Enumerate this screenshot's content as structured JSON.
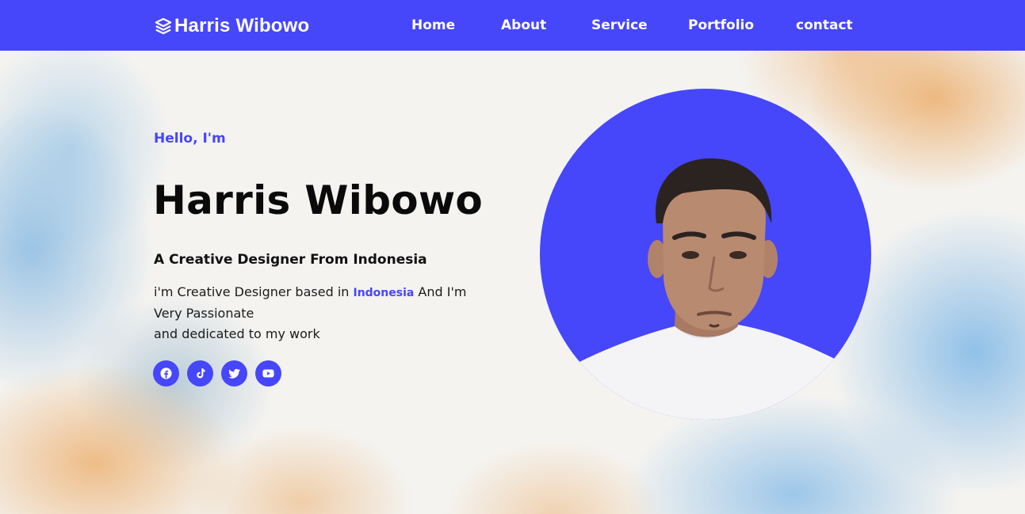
{
  "nav": {
    "brand": "Harris Wibowo",
    "brand_icon": "layers-icon",
    "links": [
      "Home",
      "About",
      "Service",
      "Portfolio",
      "contact"
    ],
    "background": "#4646fa"
  },
  "hero": {
    "greeting": "Hello, I'm",
    "name": "Harris Wibowo",
    "tagline": "A Creative Designer From Indonesia",
    "desc_before": "i'm Creative Designer based in ",
    "desc_highlight": "Indonesia",
    "desc_after": " And I'm Very Passionate",
    "desc_line2": "and dedicated to my work",
    "socials": [
      "facebook-icon",
      "tiktok-icon",
      "twitter-icon",
      "youtube-icon"
    ],
    "accent": "#4646fa"
  }
}
